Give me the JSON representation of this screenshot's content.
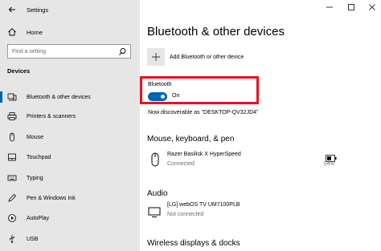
{
  "window": {
    "title": "Settings"
  },
  "sidebar": {
    "home": "Home",
    "search_placeholder": "Find a setting",
    "section": "Devices",
    "items": [
      {
        "label": "Bluetooth & other devices",
        "icon": "bluetooth-devices-icon",
        "selected": true
      },
      {
        "label": "Printers & scanners",
        "icon": "printer-icon"
      },
      {
        "label": "Mouse",
        "icon": "mouse-icon"
      },
      {
        "label": "Touchpad",
        "icon": "touchpad-icon"
      },
      {
        "label": "Typing",
        "icon": "keyboard-icon"
      },
      {
        "label": "Pen & Windows Ink",
        "icon": "pen-icon"
      },
      {
        "label": "AutoPlay",
        "icon": "autoplay-icon"
      },
      {
        "label": "USB",
        "icon": "usb-icon"
      }
    ]
  },
  "main": {
    "title": "Bluetooth & other devices",
    "add_device": "Add Bluetooth or other device",
    "bluetooth": {
      "label": "Bluetooth",
      "state": "On",
      "discoverable": "Now discoverable as \"DESKTOP-QV32JD4\""
    },
    "sections": {
      "mouse": "Mouse, keyboard, & pen",
      "audio": "Audio",
      "wireless": "Wireless displays & docks"
    },
    "devices": {
      "mouse": {
        "name": "Razer Basilisk X HyperSpeed",
        "status": "Connected",
        "battery": "54%"
      },
      "audio": {
        "name": "[LG] webOS TV UM7100PLB",
        "status": "Not connected"
      }
    }
  },
  "colors": {
    "accent": "#0063b1",
    "highlight": "#e81123",
    "sidebar_bg": "#e6e6e6"
  }
}
